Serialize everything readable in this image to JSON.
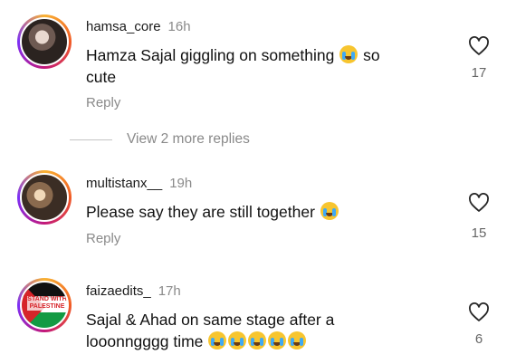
{
  "comments": [
    {
      "username": "hamsa_core",
      "time": "16h",
      "text_line1": "Hamza Sajal giggling on something",
      "text_after_emoji": "so",
      "text_line2": "cute",
      "reply": "Reply",
      "likes": "17",
      "emoji_icon": "face-with-tears-of-joy"
    },
    {
      "username": "multistanx__",
      "time": "19h",
      "text_line1": "Please say they are still together",
      "reply": "Reply",
      "likes": "15",
      "emoji_icon": "loudly-crying-face"
    },
    {
      "username": "faizaedits_",
      "time": "17h",
      "text_line1": "Sajal & Ahad on same stage after a",
      "text_line2": "looonngggg time",
      "likes": "6",
      "emoji_icon": "loudly-crying-face",
      "emoji_count": 5,
      "avatar_text": "STAND WITH PALESTINE"
    }
  ],
  "view_more": "View 2 more replies",
  "colors": {
    "secondary_text": "#8a8a8a",
    "primary_text": "#111111",
    "divider": "#c4c4c4"
  }
}
